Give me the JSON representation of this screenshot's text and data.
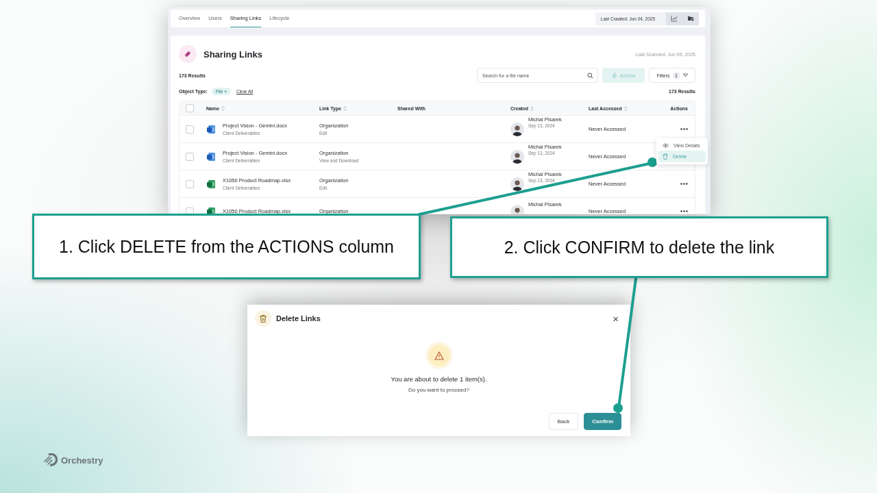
{
  "tabs": [
    {
      "label": "Overview",
      "selected": false
    },
    {
      "label": "Users",
      "selected": false
    },
    {
      "label": "Sharing Links",
      "selected": true
    },
    {
      "label": "Lifecycle",
      "selected": false
    }
  ],
  "last_crawled": "Last Crawled: Jun 04, 2025",
  "panel": {
    "title": "Sharing Links",
    "last_scanned": "Last Scanned: Jun 05, 2025",
    "results": "173 Results",
    "search": {
      "placeholder": "Search for a file name"
    },
    "actions_button": {
      "label": "Actions",
      "disabled": true
    },
    "filters": {
      "label": "Filters",
      "count": "1"
    },
    "filter_label": "Object Type:",
    "chips": [
      {
        "label": "File",
        "remove": "×"
      }
    ],
    "clear_all": "Clear All",
    "results_right": "173 Results"
  },
  "table": {
    "columns": [
      {
        "label": "Name",
        "sortable": true
      },
      {
        "label": "Link Type",
        "sortable": true
      },
      {
        "label": "Shared With",
        "sortable": false
      },
      {
        "label": "Created",
        "sortable": true
      },
      {
        "label": "Last Accessed",
        "sortable": true
      },
      {
        "label": "Actions",
        "sortable": false
      }
    ],
    "header_checked": false,
    "rows": [
      {
        "kind": "document",
        "checked": false,
        "name": "Project Vision - Gemini.docx",
        "folder": "Client Deliverables",
        "link_type": "Organization",
        "permission": "Edit",
        "creator": "Michal Pisarek",
        "created_date": "Sep 13, 2024",
        "last_accessed": "Never Accessed",
        "menu_open": false
      },
      {
        "kind": "document",
        "checked": false,
        "name": "Project Vision - Gemini.docx",
        "folder": "Client Deliverables",
        "link_type": "Organization",
        "permission": "View and Download",
        "creator": "Michal Pisarek",
        "created_date": "Sep 13, 2024",
        "last_accessed": "Never Accessed",
        "menu_open": true
      },
      {
        "kind": "spreadsheet",
        "checked": false,
        "name": "X1050 Product Roadmap.xlsx",
        "folder": "Client Deliverables",
        "link_type": "Organization",
        "permission": "Edit",
        "creator": "Michal Pisarek",
        "created_date": "Sep 13, 2024",
        "last_accessed": "Never Accessed",
        "menu_open": false
      },
      {
        "kind": "spreadsheet",
        "checked": false,
        "name": "X1050 Product Roadmap.xlsx",
        "link_type": "Organization",
        "creator": "Michal Pisarek",
        "last_accessed": "Never Accessed",
        "menu_open": false
      }
    ]
  },
  "row_menu": {
    "items": [
      {
        "label": "View Details",
        "selected": false
      },
      {
        "label": "Delete",
        "selected": true
      }
    ]
  },
  "callouts": [
    {
      "text": "1. Click DELETE from the ACTIONS column"
    },
    {
      "text": "2. Click CONFIRM to delete the link"
    }
  ],
  "dialog": {
    "title": "Delete Links",
    "close": "×",
    "message": "You are about to delete 1 item(s).",
    "question": "Do you want to proceed?",
    "buttons": [
      {
        "label": "Back",
        "primary": false
      },
      {
        "label": "Confirm",
        "primary": true
      }
    ]
  },
  "logo": "Orchestry"
}
